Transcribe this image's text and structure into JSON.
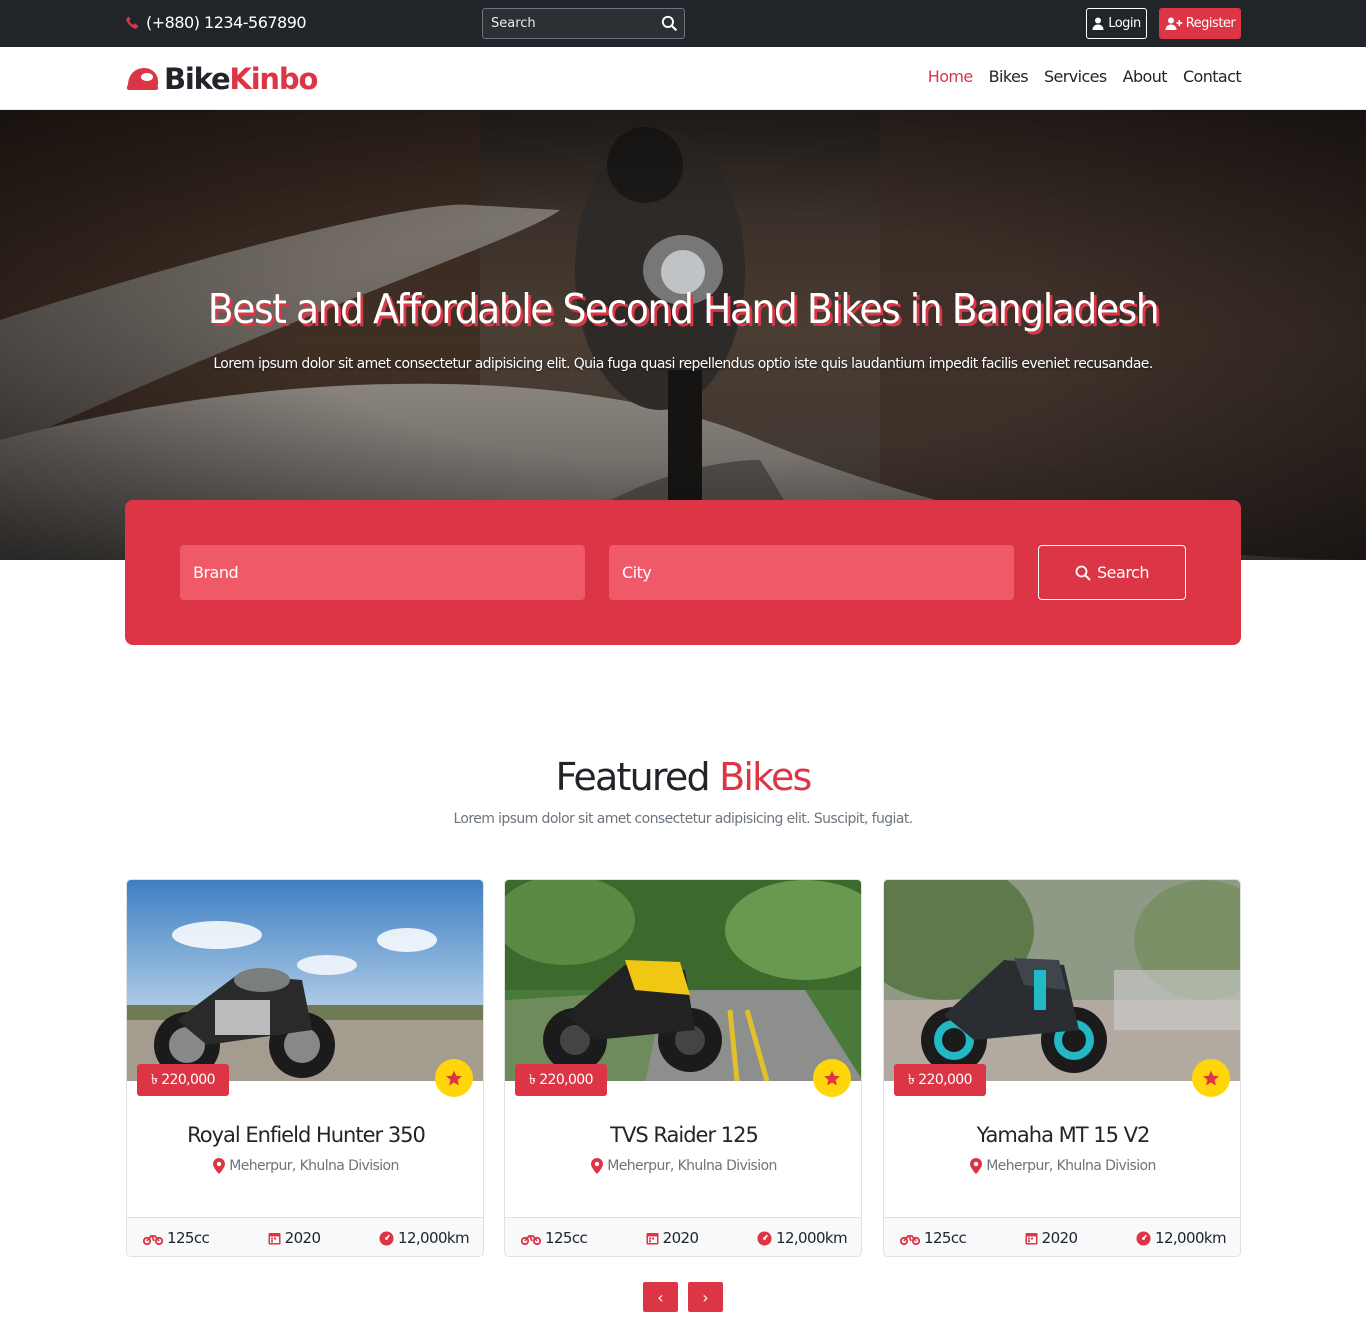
{
  "topbar": {
    "phone": "(+880) 1234-567890",
    "search_placeholder": "Search",
    "login_label": "Login",
    "register_label": "Register"
  },
  "nav": {
    "logo_part1": "Bike",
    "logo_part2": "Kinbo",
    "links": [
      {
        "label": "Home",
        "active": true
      },
      {
        "label": "Bikes",
        "active": false
      },
      {
        "label": "Services",
        "active": false
      },
      {
        "label": "About",
        "active": false
      },
      {
        "label": "Contact",
        "active": false
      }
    ]
  },
  "hero": {
    "title": "Best and Affordable Second Hand Bikes in Bangladesh",
    "subtitle": "Lorem ipsum dolor sit amet consectetur adipisicing elit. Quia fuga quasi repellendus optio iste quis laudantium impedit facilis eveniet recusandae."
  },
  "search_panel": {
    "brand_placeholder": "Brand",
    "city_placeholder": "City",
    "button_label": "Search"
  },
  "featured": {
    "title_part1": "Featured",
    "title_part2": "Bikes",
    "subtitle": "Lorem ipsum dolor sit amet consectetur adipisicing elit. Suscipit, fugiat.",
    "bikes": [
      {
        "name": "Royal Enfield Hunter 350",
        "price": "৳ 220,000",
        "location": "Meherpur, Khulna Division",
        "cc": "125cc",
        "year": "2020",
        "km": "12,000km"
      },
      {
        "name": "TVS Raider 125",
        "price": "৳ 220,000",
        "location": "Meherpur, Khulna Division",
        "cc": "125cc",
        "year": "2020",
        "km": "12,000km"
      },
      {
        "name": "Yamaha MT 15 V2",
        "price": "৳ 220,000",
        "location": "Meherpur, Khulna Division",
        "cc": "125cc",
        "year": "2020",
        "km": "12,000km"
      }
    ],
    "prev_label": "‹",
    "next_label": "›"
  },
  "colors": {
    "accent": "#dc3545",
    "dark": "#212529",
    "star_badge": "#ffd60a"
  },
  "icons": [
    "phone-icon",
    "search-icon",
    "user-icon",
    "user-plus-icon",
    "helmet-logo-icon",
    "star-icon",
    "location-pin-icon",
    "motorcycle-icon",
    "calendar-icon",
    "speedometer-icon"
  ]
}
